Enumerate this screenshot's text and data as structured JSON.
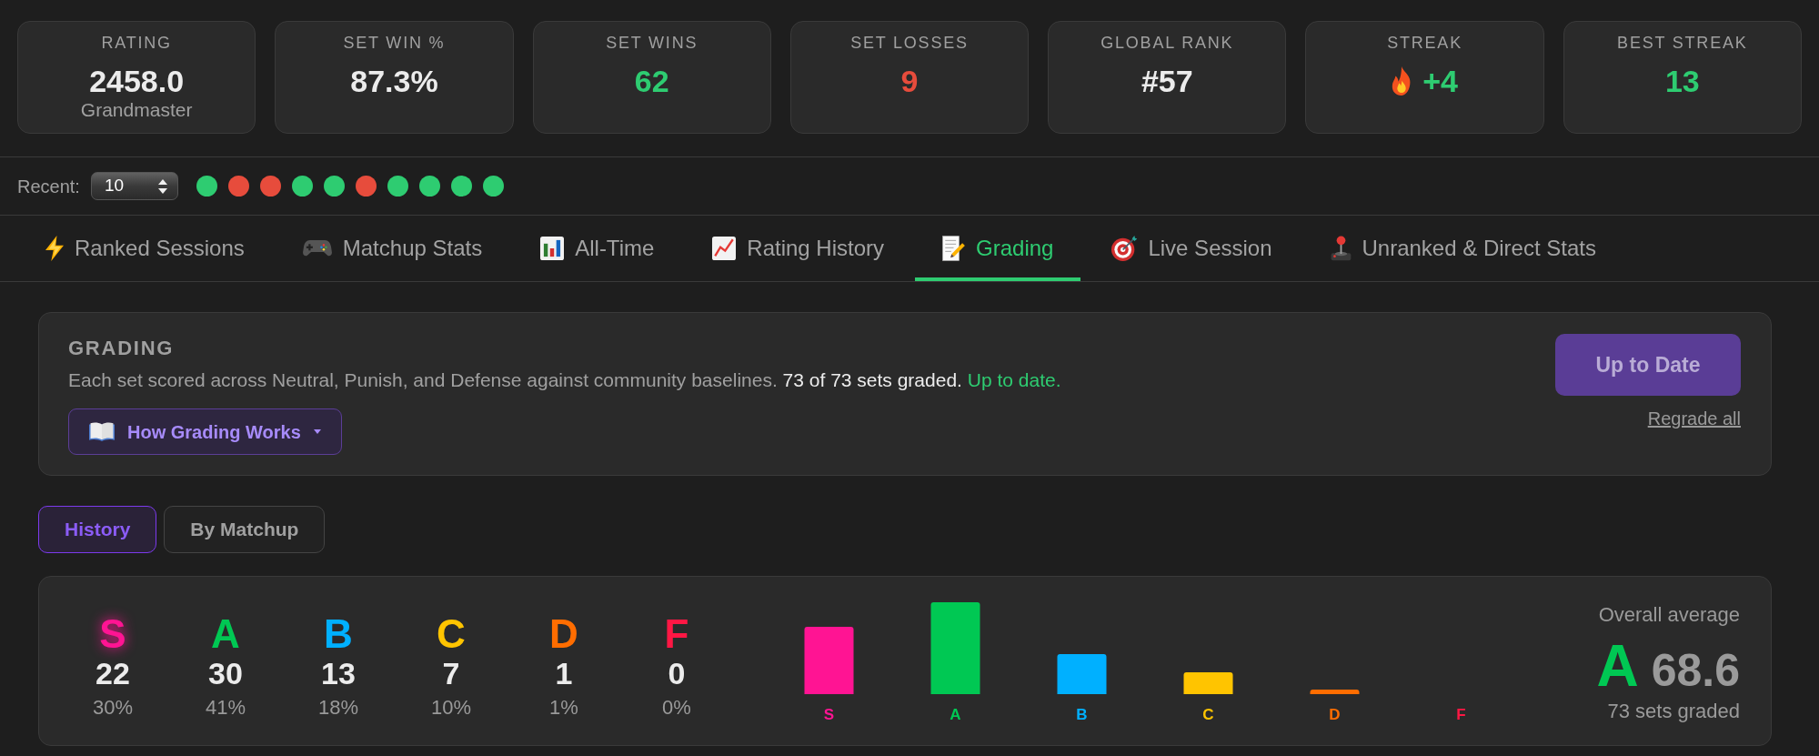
{
  "stats": [
    {
      "kind": "value",
      "label": "RATING",
      "value": "2458.0",
      "color": "#ececec",
      "sub": "Grandmaster"
    },
    {
      "kind": "value",
      "label": "SET WIN %",
      "value": "87.3%",
      "color": "#ececec"
    },
    {
      "kind": "value",
      "label": "SET WINS",
      "value": "62",
      "color": "#2ecc71"
    },
    {
      "kind": "value",
      "label": "SET LOSSES",
      "value": "9",
      "color": "#e74c3c"
    },
    {
      "kind": "value",
      "label": "GLOBAL RANK",
      "value": "#57",
      "color": "#ececec"
    },
    {
      "kind": "streak",
      "label": "STREAK",
      "value": "+4",
      "color": "#2ecc71"
    },
    {
      "kind": "value",
      "label": "BEST STREAK",
      "value": "13",
      "color": "#2ecc71"
    }
  ],
  "recent": {
    "label": "Recent:",
    "count": "10",
    "results": [
      {
        "color": "#2ecc71"
      },
      {
        "color": "#e74c3c"
      },
      {
        "color": "#e74c3c"
      },
      {
        "color": "#2ecc71"
      },
      {
        "color": "#2ecc71"
      },
      {
        "color": "#e74c3c"
      },
      {
        "color": "#2ecc71"
      },
      {
        "color": "#2ecc71"
      },
      {
        "color": "#2ecc71"
      },
      {
        "color": "#2ecc71"
      }
    ]
  },
  "tabs": [
    {
      "label": "Ranked Sessions",
      "selected": false
    },
    {
      "label": "Matchup Stats",
      "selected": false
    },
    {
      "label": "All-Time",
      "selected": false
    },
    {
      "label": "Rating History",
      "selected": false
    },
    {
      "label": "Grading",
      "selected": true
    },
    {
      "label": "Live Session",
      "selected": false
    },
    {
      "label": "Unranked & Direct Stats",
      "selected": false
    }
  ],
  "grading": {
    "title": "GRADING",
    "description": "Each set scored across Neutral, Punish, and Defense against community baselines.",
    "graded": "73 of 73 sets graded.",
    "status": "Up to date.",
    "guide_button": "How Grading Works",
    "action": {
      "label": "Up to Date",
      "disabled": true
    },
    "regrade_link": "Regrade all"
  },
  "view_tabs": [
    {
      "label": "History",
      "selected": true
    },
    {
      "label": "By Matchup",
      "selected": false
    }
  ],
  "summary": {
    "grades": [
      {
        "letter": "S",
        "count": "22",
        "percent": "30%",
        "color": "#ff1493",
        "glow": true
      },
      {
        "letter": "A",
        "count": "30",
        "percent": "41%",
        "color": "#00c853",
        "glow": false
      },
      {
        "letter": "B",
        "count": "13",
        "percent": "18%",
        "color": "#00b0ff",
        "glow": false
      },
      {
        "letter": "C",
        "count": "7",
        "percent": "10%",
        "color": "#ffc400",
        "glow": false
      },
      {
        "letter": "D",
        "count": "1",
        "percent": "1%",
        "color": "#ff6d00",
        "glow": false
      },
      {
        "letter": "F",
        "count": "0",
        "percent": "0%",
        "color": "#ff1744",
        "glow": false
      }
    ],
    "bar_labels": [
      "S",
      "A",
      "B",
      "C",
      "D",
      "F"
    ],
    "overall": {
      "label": "Overall average",
      "grade": "A",
      "color": "#00c853",
      "score": "68.6",
      "count": "73 sets graded"
    }
  }
}
